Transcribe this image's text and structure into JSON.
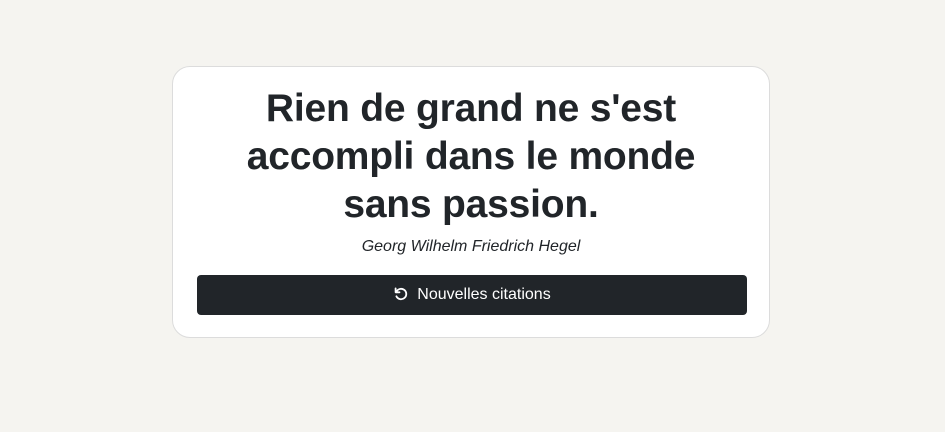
{
  "quote": {
    "text": "Rien de grand ne s'est accompli dans le monde sans passion.",
    "author": "Georg Wilhelm Friedrich Hegel"
  },
  "actions": {
    "refresh_label": "Nouvelles citations",
    "refresh_icon": "rotate-ccw-icon"
  },
  "colors": {
    "background": "#f5f4f0",
    "card": "#ffffff",
    "button": "#212529",
    "text": "#212529"
  }
}
